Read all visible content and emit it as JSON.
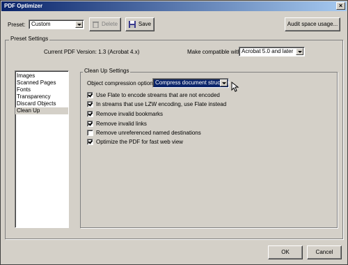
{
  "window": {
    "title": "PDF Optimizer"
  },
  "top": {
    "preset_label": "Preset:",
    "preset_value": "Custom",
    "delete_label": "Delete",
    "save_label": "Save",
    "audit_label": "Audit space usage..."
  },
  "preset_settings": {
    "title": "Preset Settings",
    "current_version": "Current PDF Version: 1.3 (Acrobat 4.x)",
    "compat_label": "Make compatible with:",
    "compat_value": "Acrobat 5.0 and later"
  },
  "sidebar": {
    "items": [
      {
        "label": "Images"
      },
      {
        "label": "Scanned Pages"
      },
      {
        "label": "Fonts"
      },
      {
        "label": "Transparency"
      },
      {
        "label": "Discard Objects"
      },
      {
        "label": "Clean Up"
      }
    ],
    "selected": "Clean Up"
  },
  "cleanup": {
    "title": "Clean Up Settings",
    "compression_label": "Object compression options:",
    "compression_value": "Compress document structure",
    "options": [
      {
        "label": "Use Flate to encode streams that are not encoded",
        "checked": true
      },
      {
        "label": "In streams that use LZW encoding, use Flate instead",
        "checked": true
      },
      {
        "label": "Remove invalid bookmarks",
        "checked": true
      },
      {
        "label": "Remove invalid links",
        "checked": true
      },
      {
        "label": "Remove unreferenced named destinations",
        "checked": false
      },
      {
        "label": "Optimize the PDF for fast web view",
        "checked": true
      }
    ]
  },
  "footer": {
    "ok_label": "OK",
    "cancel_label": "Cancel"
  }
}
